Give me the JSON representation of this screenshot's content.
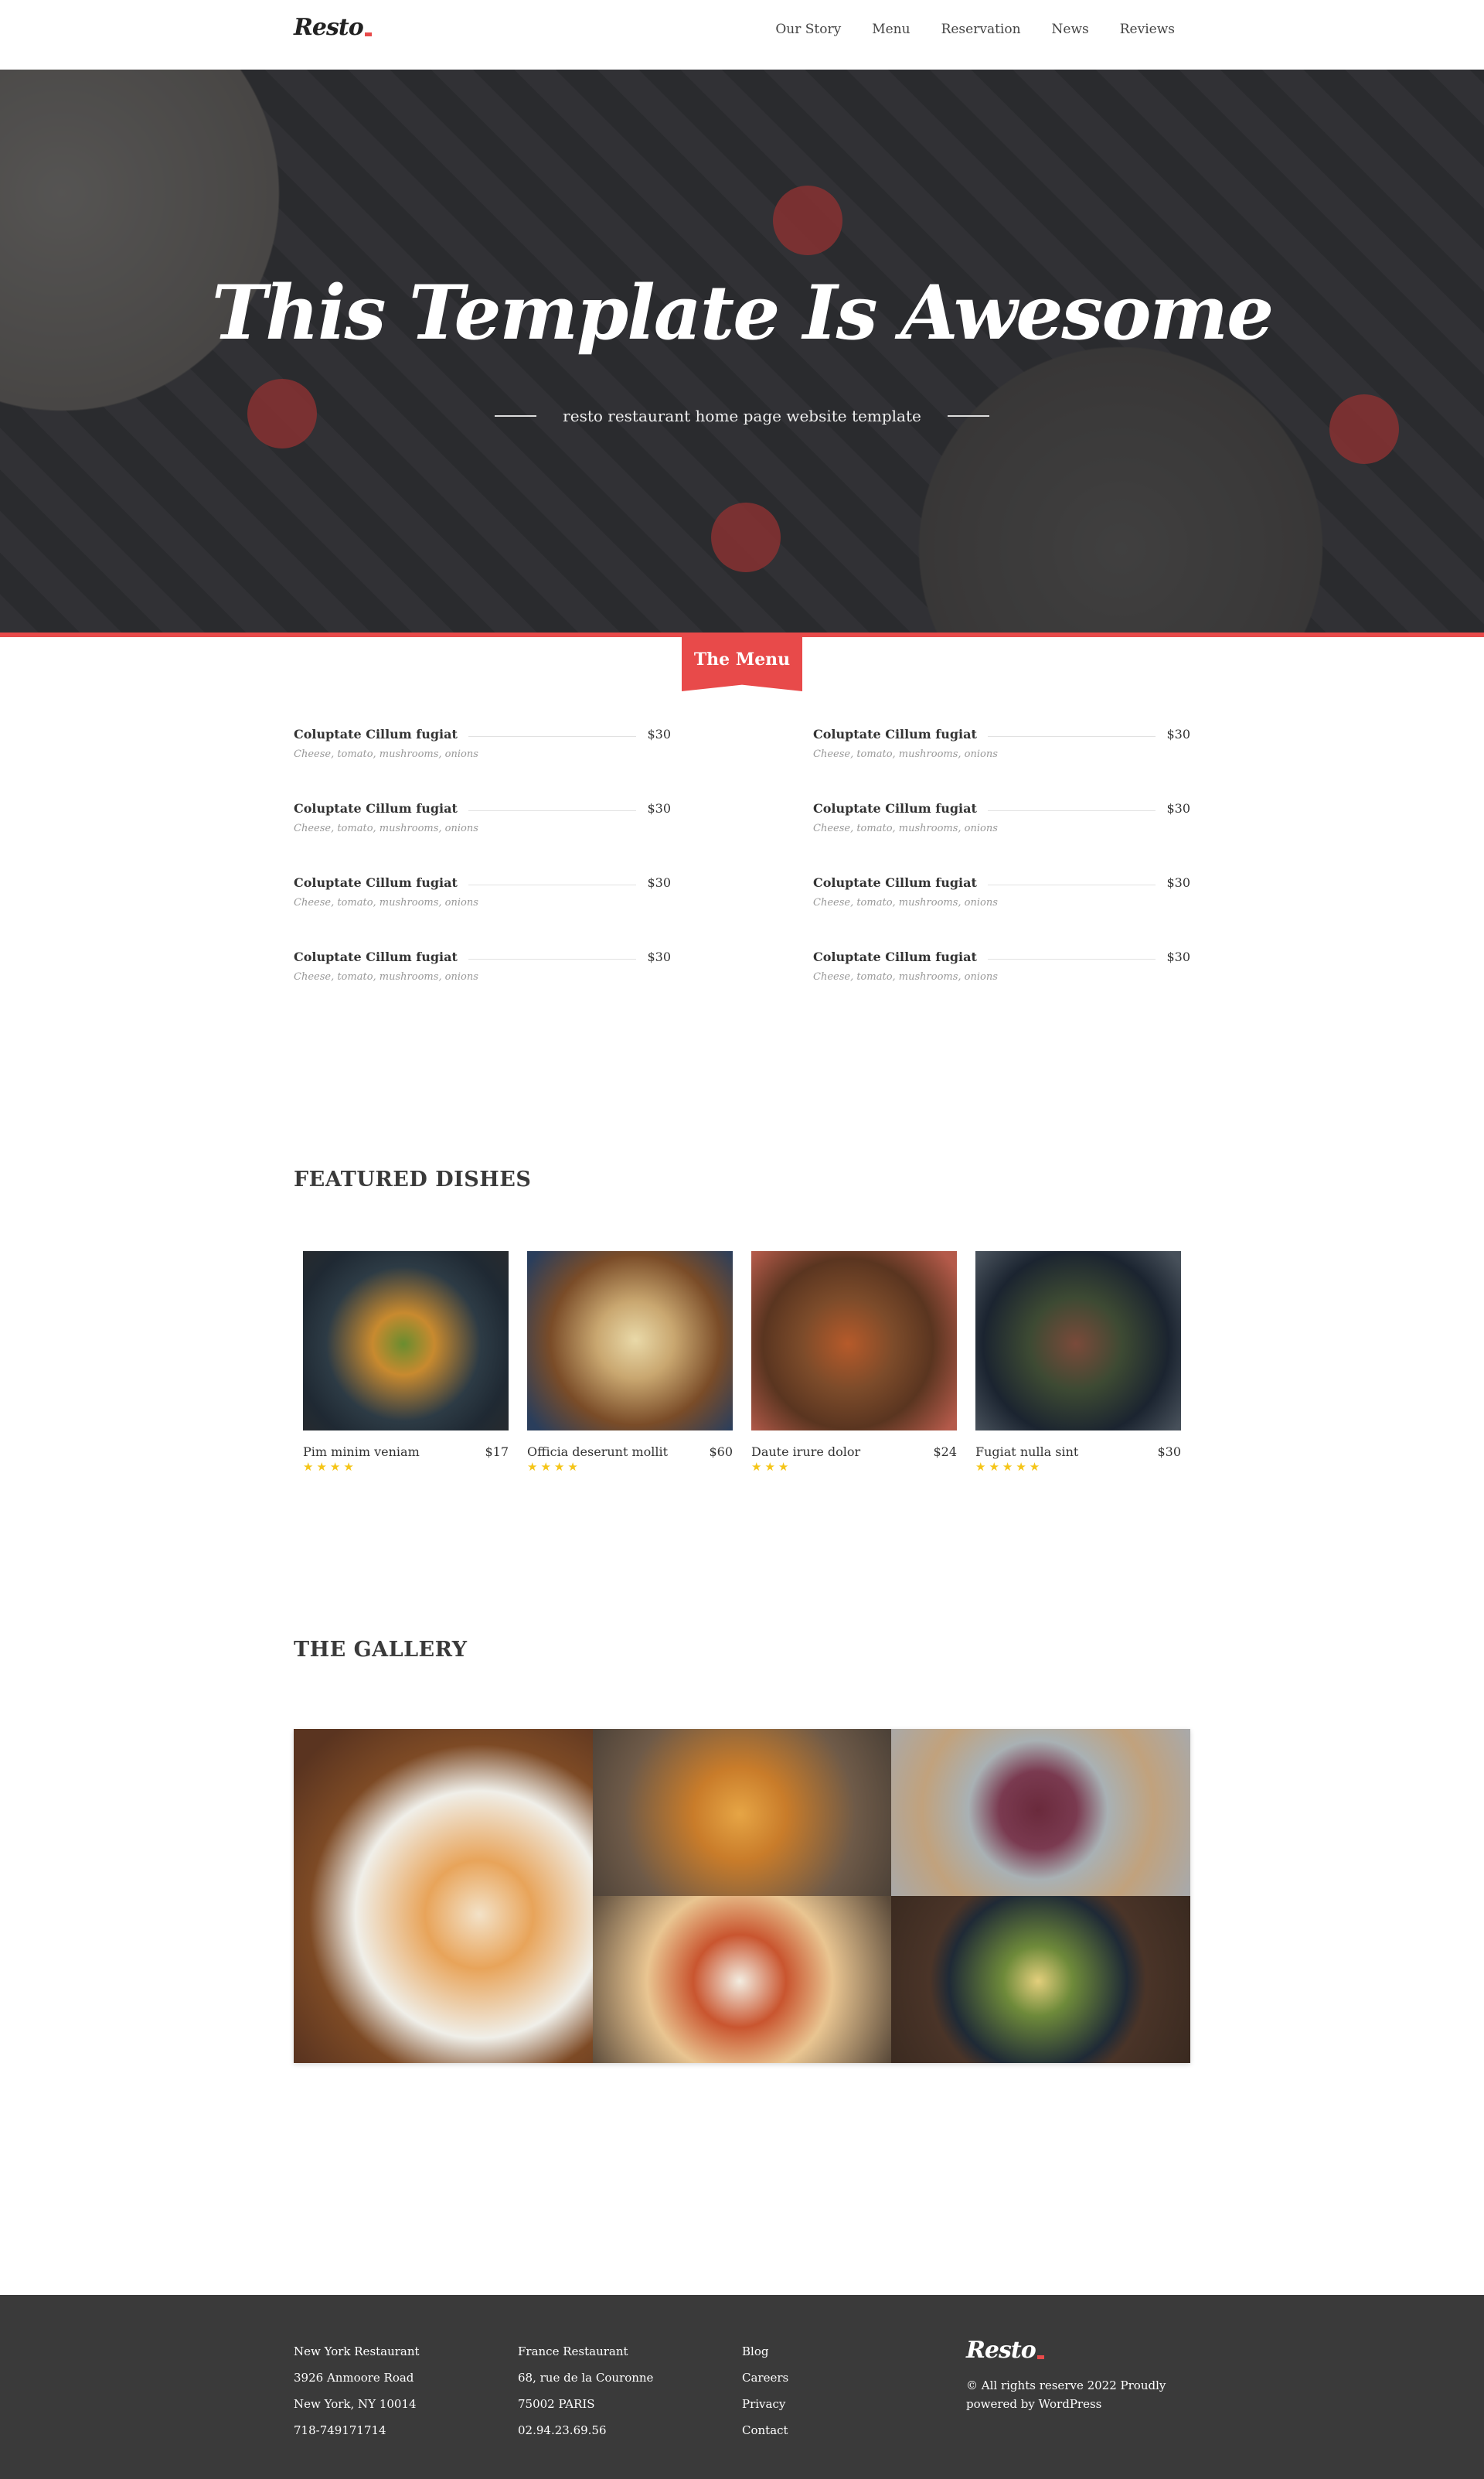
{
  "header": {
    "logo": "Resto",
    "nav": [
      "Our Story",
      "Menu",
      "Reservation",
      "News",
      "Reviews"
    ]
  },
  "hero": {
    "title": "This Template Is Awesome",
    "subtitle": "resto restaurant home page website template"
  },
  "menu": {
    "tab_label": "The Menu",
    "items": [
      {
        "name": "Coluptate Cillum fugiat",
        "price": "$30",
        "desc": "Cheese, tomato, mushrooms, onions"
      },
      {
        "name": "Coluptate Cillum fugiat",
        "price": "$30",
        "desc": "Cheese, tomato, mushrooms, onions"
      },
      {
        "name": "Coluptate Cillum fugiat",
        "price": "$30",
        "desc": "Cheese, tomato, mushrooms, onions"
      },
      {
        "name": "Coluptate Cillum fugiat",
        "price": "$30",
        "desc": "Cheese, tomato, mushrooms, onions"
      },
      {
        "name": "Coluptate Cillum fugiat",
        "price": "$30",
        "desc": "Cheese, tomato, mushrooms, onions"
      },
      {
        "name": "Coluptate Cillum fugiat",
        "price": "$30",
        "desc": "Cheese, tomato, mushrooms, onions"
      },
      {
        "name": "Coluptate Cillum fugiat",
        "price": "$30",
        "desc": "Cheese, tomato, mushrooms, onions"
      },
      {
        "name": "Coluptate Cillum fugiat",
        "price": "$30",
        "desc": "Cheese, tomato, mushrooms, onions"
      }
    ]
  },
  "featured": {
    "title": "FEATURED DISHES",
    "dishes": [
      {
        "name": "Pim minim veniam",
        "price": "$17",
        "stars": "★★★★",
        "rating": 4
      },
      {
        "name": "Officia deserunt mollit",
        "price": "$60",
        "stars": "★★★★",
        "rating": 4
      },
      {
        "name": "Daute irure dolor",
        "price": "$24",
        "stars": "★★★",
        "rating": 3
      },
      {
        "name": "Fugiat nulla sint",
        "price": "$30",
        "stars": "★★★★★",
        "rating": 5
      }
    ]
  },
  "gallery": {
    "title": "THE GALLERY"
  },
  "footer": {
    "col1": [
      "New York Restaurant",
      "3926 Anmoore Road",
      "New York, NY 10014",
      "718-749171714"
    ],
    "col2": [
      "France Restaurant",
      "68, rue de la Couronne",
      "75002 PARIS",
      "02.94.23.69.56"
    ],
    "col3": [
      "Blog",
      "Careers",
      "Privacy",
      "Contact"
    ],
    "logo": "Resto",
    "copyright": "© All rights reserve 2022 Proudly powered by WordPress"
  },
  "colors": {
    "accent": "#e84a4a",
    "footer_bg": "#3a3a3a",
    "star": "#f5c518"
  }
}
